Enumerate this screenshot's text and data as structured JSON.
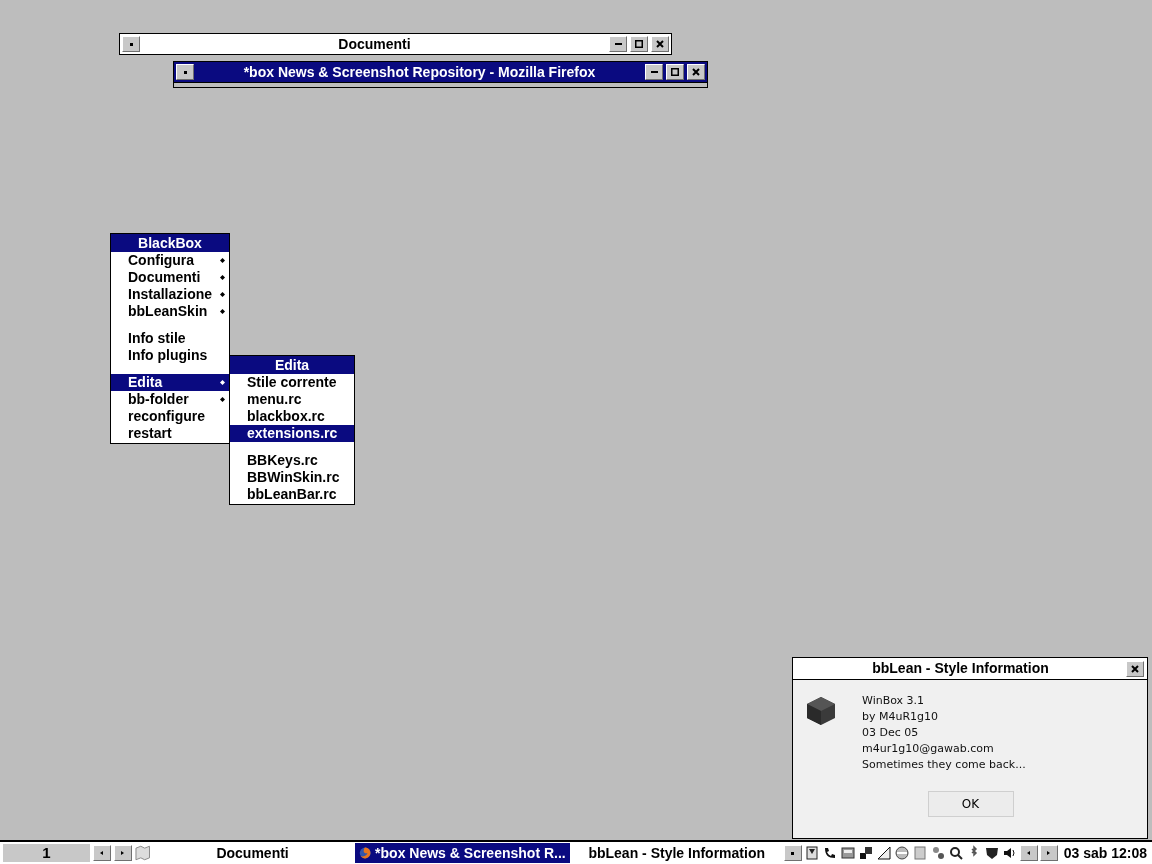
{
  "windows": [
    {
      "title": "Documenti",
      "active": false
    },
    {
      "title": "*box News & Screenshot Repository - Mozilla Firefox",
      "active": true
    }
  ],
  "root_menu": {
    "title": "BlackBox",
    "items": [
      {
        "kind": "submenu",
        "label": "Configura",
        "selected": false
      },
      {
        "kind": "submenu",
        "label": "Documenti",
        "selected": false
      },
      {
        "kind": "submenu",
        "label": "Installazione",
        "selected": false
      },
      {
        "kind": "submenu",
        "label": "bbLeanSkin",
        "selected": false
      },
      {
        "kind": "separator"
      },
      {
        "kind": "command",
        "label": "Info stile",
        "selected": false
      },
      {
        "kind": "command",
        "label": "Info plugins",
        "selected": false
      },
      {
        "kind": "separator"
      },
      {
        "kind": "submenu",
        "label": "Edita",
        "selected": true
      },
      {
        "kind": "submenu",
        "label": "bb-folder",
        "selected": false
      },
      {
        "kind": "command",
        "label": "reconfigure",
        "selected": false
      },
      {
        "kind": "command",
        "label": "restart",
        "selected": false
      }
    ]
  },
  "sub_menu": {
    "title": "Edita",
    "items": [
      {
        "kind": "command",
        "label": "Stile corrente",
        "selected": false
      },
      {
        "kind": "command",
        "label": "menu.rc",
        "selected": false
      },
      {
        "kind": "command",
        "label": "blackbox.rc",
        "selected": false
      },
      {
        "kind": "command",
        "label": "extensions.rc",
        "selected": true
      },
      {
        "kind": "separator"
      },
      {
        "kind": "command",
        "label": "BBKeys.rc",
        "selected": false
      },
      {
        "kind": "command",
        "label": "BBWinSkin.rc",
        "selected": false
      },
      {
        "kind": "command",
        "label": "bbLeanBar.rc",
        "selected": false
      }
    ]
  },
  "dialog": {
    "title": "bbLean - Style Information",
    "lines": [
      "WinBox 3.1",
      "by M4uR1g10",
      "03 Dec 05",
      "m4ur1g10@gawab.com",
      "Sometimes they come back..."
    ],
    "button": "OK"
  },
  "taskbar": {
    "workspace": "1",
    "tasks": [
      {
        "label": "Documenti",
        "selected": false,
        "kind": "plain"
      },
      {
        "label": "*box News & Screenshot R...",
        "selected": true,
        "kind": "browser"
      },
      {
        "label": "bbLean - Style Information",
        "selected": false,
        "kind": "plain"
      }
    ],
    "clock": "03 sab 12:08"
  }
}
